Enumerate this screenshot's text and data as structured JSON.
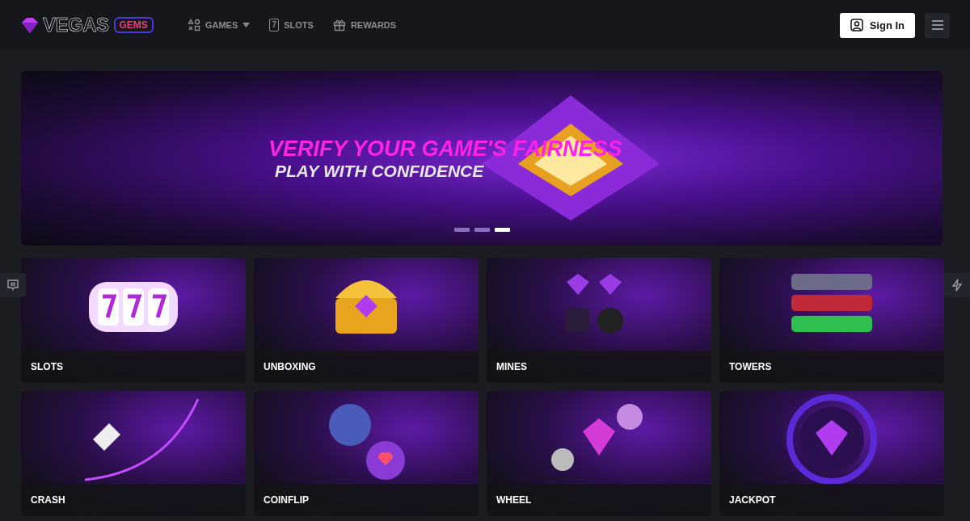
{
  "header": {
    "logo": {
      "wordmark": "VEGAS",
      "badge": "GEMS"
    },
    "nav": [
      {
        "kind": "games",
        "label": "GAMES",
        "dropdown": true
      },
      {
        "kind": "slots",
        "label": "SLOTS",
        "icon_text": "7",
        "dropdown": false
      },
      {
        "kind": "rewards",
        "label": "REWARDS",
        "dropdown": false
      }
    ],
    "sign_in": "Sign In"
  },
  "banner": {
    "title": "VERIFY YOUR GAME'S FAIRNESS",
    "subtitle": "PLAY WITH CONFIDENCE",
    "slides": [
      {
        "selected": false
      },
      {
        "selected": false
      },
      {
        "selected": true
      }
    ]
  },
  "side_tabs": [
    {
      "kind": "chat"
    },
    {
      "kind": "lightning"
    }
  ],
  "games": [
    {
      "kind": "slots",
      "label": "SLOTS"
    },
    {
      "kind": "unboxing",
      "label": "UNBOXING"
    },
    {
      "kind": "mines",
      "label": "MINES"
    },
    {
      "kind": "towers",
      "label": "TOWERS"
    },
    {
      "kind": "crash",
      "label": "CRASH"
    },
    {
      "kind": "coinflip",
      "label": "COINFLIP"
    },
    {
      "kind": "wheel",
      "label": "WHEEL"
    },
    {
      "kind": "jackpot",
      "label": "JACKPOT"
    }
  ]
}
